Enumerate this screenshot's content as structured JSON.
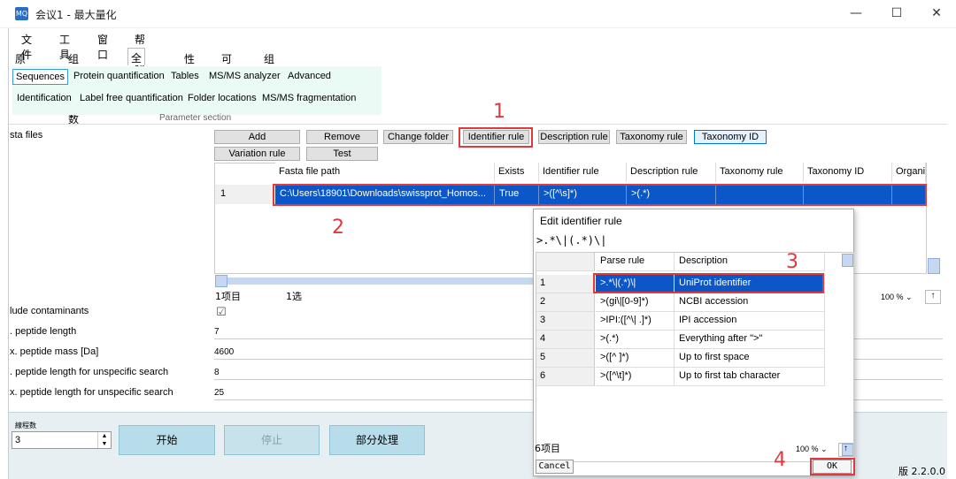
{
  "window": {
    "title": "会议1 - 最大量化",
    "icon_label": "MQ"
  },
  "menu": [
    "文件",
    "工具",
    "窗口",
    "帮帮我"
  ],
  "tabs": [
    "原始数据",
    "组特定参数",
    "全局参数",
    "性能",
    "可视化",
    "组态"
  ],
  "ribbon": {
    "row1": [
      "Sequences",
      "Protein quantification",
      "Tables",
      "MS/MS analyzer",
      "Advanced"
    ],
    "row2": [
      "Identification",
      "Label free quantification",
      "Folder locations",
      "MS/MS fragmentation"
    ],
    "section_label": "Parameter section"
  },
  "fasta": {
    "label": "sta files",
    "buttons": {
      "add": "Add",
      "remove": "Remove",
      "change_folder": "Change folder",
      "identifier_rule": "Identifier rule",
      "description_rule": "Description rule",
      "taxonomy_rule": "Taxonomy rule",
      "taxonomy_id": "Taxonomy ID",
      "variation_rule": "Variation rule",
      "test": "Test"
    },
    "columns": [
      "Fasta file path",
      "Exists",
      "Identifier rule",
      "Description rule",
      "Taxonomy rule",
      "Taxonomy ID",
      "Organi"
    ],
    "row": {
      "index": "1",
      "path": "C:\\Users\\18901\\Downloads\\swissprot_Homos...",
      "exists": "True",
      "identifier_rule": ">([^\\s]*)",
      "description_rule": ">(.*)"
    },
    "status_items": "1项目",
    "status_selected": "1选",
    "zoom": "100 %"
  },
  "params": [
    {
      "label": "lude contaminants",
      "value": "☑"
    },
    {
      "label": ". peptide length",
      "value": "7"
    },
    {
      "label": "x. peptide mass [Da]",
      "value": "4600"
    },
    {
      "label": ". peptide length for unspecific search",
      "value": "8"
    },
    {
      "label": "x. peptide length for unspecific search",
      "value": "25"
    }
  ],
  "annotations": [
    "1",
    "2",
    "3",
    "4"
  ],
  "dialog": {
    "title": "Edit identifier rule",
    "rule_text": ">.*\\|(.*)\\|",
    "columns": [
      "Parse rule",
      "Description"
    ],
    "rows": [
      {
        "index": "1",
        "rule": ">.*\\|(.*)\\|",
        "desc": "UniProt identifier"
      },
      {
        "index": "2",
        "rule": ">(gi\\|[0-9]*)",
        "desc": "NCBI accession"
      },
      {
        "index": "3",
        "rule": ">IPI:([^\\| .]*)",
        "desc": "IPI accession"
      },
      {
        "index": "4",
        "rule": ">(.*)",
        "desc": "Everything after \">\""
      },
      {
        "index": "5",
        "rule": ">([^ ]*)",
        "desc": "Up to first space"
      },
      {
        "index": "6",
        "rule": ">([^\\t]*)",
        "desc": "Up to first tab character"
      }
    ],
    "status_items": "6项目",
    "zoom": "100 %",
    "cancel": "Cancel",
    "ok": "OK"
  },
  "bottom": {
    "threads_label": "線程数",
    "threads_value": "3",
    "start": "开始",
    "stop": "停止",
    "partial": "部分处理",
    "version": "版 2.2.0.0"
  },
  "colors": {
    "accent": "#e0393e",
    "selection": "#0c57c7"
  }
}
